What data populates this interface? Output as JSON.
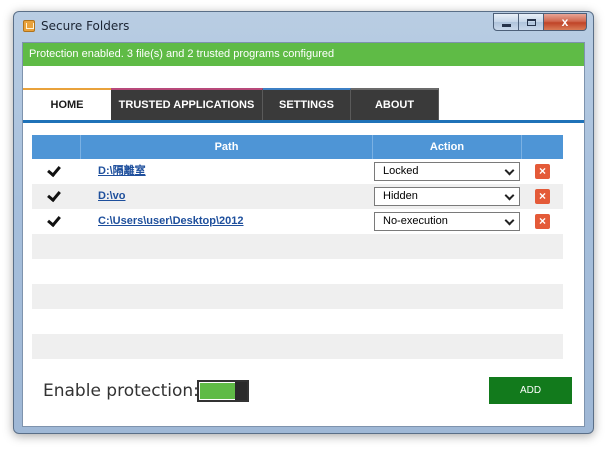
{
  "window": {
    "title": "Secure Folders",
    "controls": {
      "close_glyph": "x"
    }
  },
  "status": {
    "text": "Protection enabled. 3 file(s) and 2 trusted programs configured"
  },
  "tabs": [
    {
      "label": "HOME",
      "active": true
    },
    {
      "label": "TRUSTED APPLICATIONS",
      "active": false
    },
    {
      "label": "SETTINGS",
      "active": false
    },
    {
      "label": "ABOUT",
      "active": false
    }
  ],
  "table": {
    "headers": {
      "path": "Path",
      "action": "Action"
    },
    "rows": [
      {
        "checked": true,
        "path": "D:\\隔離室",
        "action": "Locked"
      },
      {
        "checked": true,
        "path": "D:\\vo",
        "action": "Hidden"
      },
      {
        "checked": true,
        "path": "C:\\Users\\user\\Desktop\\2012",
        "action": "No-execution"
      }
    ],
    "delete_glyph": "×"
  },
  "footer": {
    "enable_label": "Enable protection:",
    "protection_enabled": true,
    "add_label": "ADD"
  },
  "colors": {
    "status_green": "#5fbb46",
    "header_blue": "#4e95d6",
    "tab_dark": "#3a3a3a",
    "add_green": "#127a1c",
    "delete_red": "#e45a38"
  },
  "icons": [
    "app-icon",
    "minimize-icon",
    "maximize-icon",
    "close-icon",
    "checkmark-icon",
    "chevron-down-icon",
    "delete-icon"
  ]
}
